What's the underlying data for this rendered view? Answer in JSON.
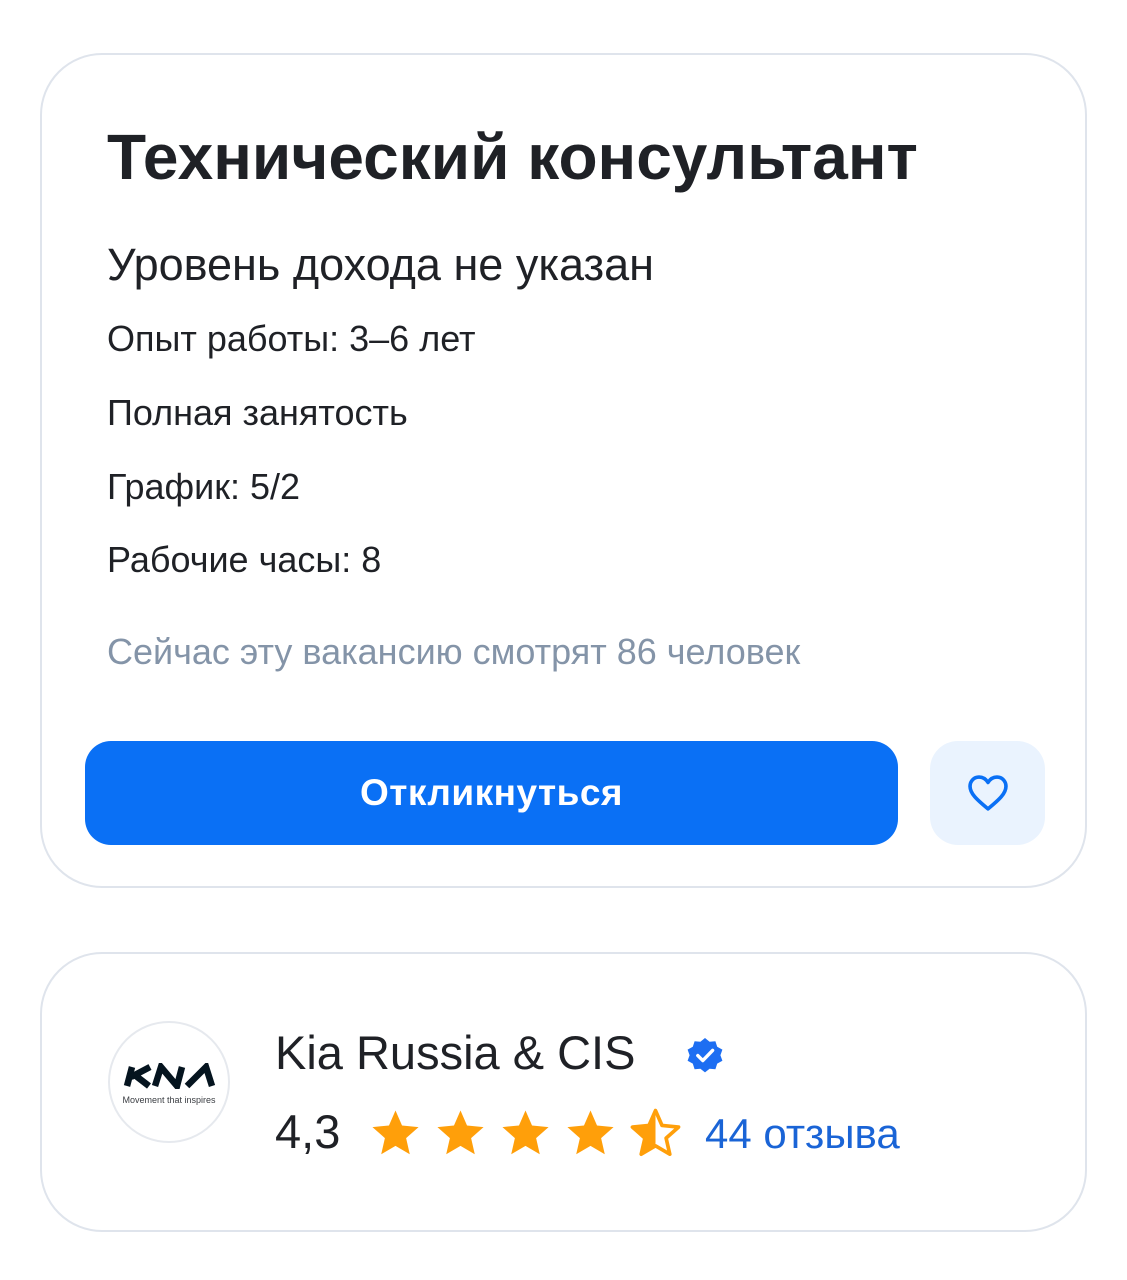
{
  "vacancy": {
    "title": "Технический консультант",
    "salary": "Уровень дохода не указан",
    "details": [
      "Опыт работы: 3–6 лет",
      "Полная занятость",
      "График: 5/2",
      "Рабочие часы: 8"
    ],
    "viewers_text": "Сейчас эту вакансию смотрят 86 человек",
    "apply_label": "Откликнуться",
    "favorite_icon": "heart-icon"
  },
  "employer": {
    "logo_slogan": "Movement that inspires",
    "name": "Kia Russia & CIS",
    "verified_icon": "verified-badge-icon",
    "rating": "4,3",
    "stars_value": 4.3,
    "stars_max": 5,
    "reviews_label": "44 отзыва"
  },
  "colors": {
    "primary": "#0a70f5",
    "favorite_bg": "#eaf3fe",
    "muted_text": "#8494a8",
    "star": "#ff9f0a",
    "link": "#1a64d6",
    "card_border": "#dfe4ec"
  }
}
